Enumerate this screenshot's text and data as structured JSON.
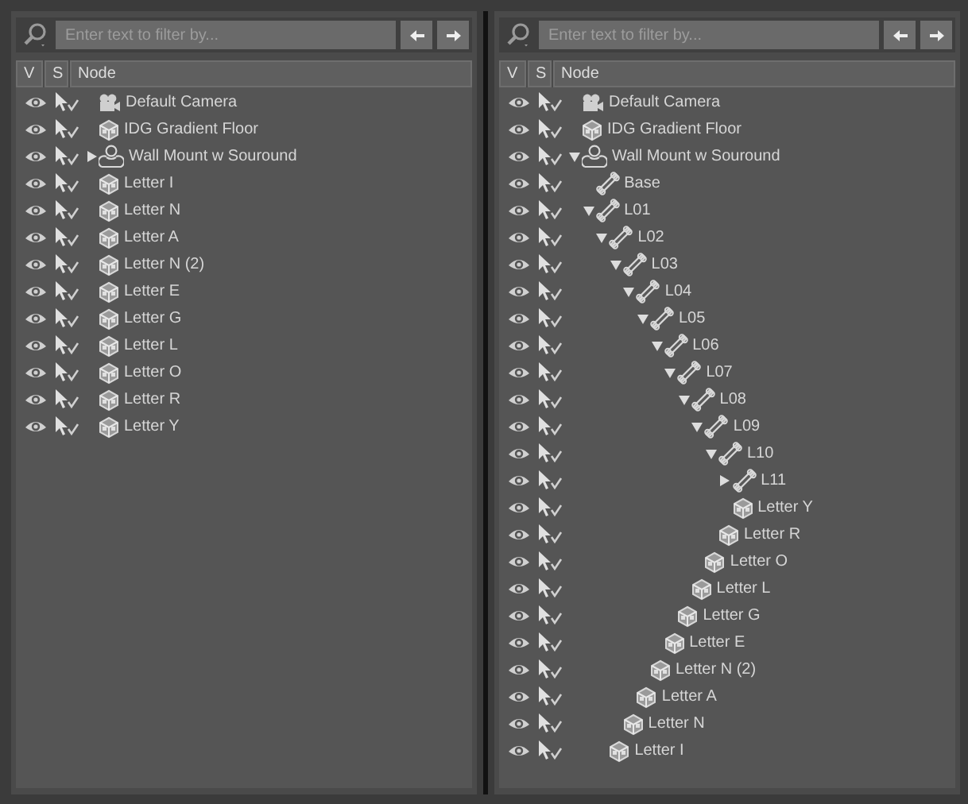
{
  "panels": [
    {
      "filter": {
        "placeholder": "Enter text to filter by..."
      },
      "columns": [
        "V",
        "S",
        "Node"
      ],
      "nodes": [
        {
          "kind": "camera",
          "label": "Default Camera"
        },
        {
          "kind": "prop",
          "label": "IDG Gradient Floor"
        },
        {
          "kind": "figure",
          "label": "Wall Mount w Souround",
          "expanded": false
        },
        {
          "kind": "prop",
          "label": "Letter I"
        },
        {
          "kind": "prop",
          "label": "Letter N"
        },
        {
          "kind": "prop",
          "label": "Letter A"
        },
        {
          "kind": "prop",
          "label": "Letter N (2)"
        },
        {
          "kind": "prop",
          "label": "Letter E"
        },
        {
          "kind": "prop",
          "label": "Letter G"
        },
        {
          "kind": "prop",
          "label": "Letter L"
        },
        {
          "kind": "prop",
          "label": "Letter O"
        },
        {
          "kind": "prop",
          "label": "Letter R"
        },
        {
          "kind": "prop",
          "label": "Letter Y"
        }
      ]
    },
    {
      "filter": {
        "placeholder": "Enter text to filter by..."
      },
      "columns": [
        "V",
        "S",
        "Node"
      ],
      "nodes": [
        {
          "kind": "camera",
          "label": "Default Camera"
        },
        {
          "kind": "prop",
          "label": "IDG Gradient Floor"
        },
        {
          "kind": "figure",
          "label": "Wall Mount w Souround",
          "expanded": true,
          "children": [
            {
              "kind": "bone",
              "label": "Base"
            },
            {
              "kind": "bone",
              "label": "L01",
              "expanded": true,
              "children": [
                {
                  "kind": "bone",
                  "label": "L02",
                  "expanded": true,
                  "children": [
                    {
                      "kind": "bone",
                      "label": "L03",
                      "expanded": true,
                      "children": [
                        {
                          "kind": "bone",
                          "label": "L04",
                          "expanded": true,
                          "children": [
                            {
                              "kind": "bone",
                              "label": "L05",
                              "expanded": true,
                              "children": [
                                {
                                  "kind": "bone",
                                  "label": "L06",
                                  "expanded": true,
                                  "children": [
                                    {
                                      "kind": "bone",
                                      "label": "L07",
                                      "expanded": true,
                                      "children": [
                                        {
                                          "kind": "bone",
                                          "label": "L08",
                                          "expanded": true,
                                          "children": [
                                            {
                                              "kind": "bone",
                                              "label": "L09",
                                              "expanded": true,
                                              "children": [
                                                {
                                                  "kind": "bone",
                                                  "label": "L10",
                                                  "expanded": true,
                                                  "children": [
                                                    {
                                                      "kind": "bone",
                                                      "label": "L11",
                                                      "expanded": false
                                                    },
                                                    {
                                                      "kind": "prop",
                                                      "label": "Letter Y"
                                                    }
                                                  ]
                                                },
                                                {
                                                  "kind": "prop",
                                                  "label": "Letter R"
                                                }
                                              ]
                                            },
                                            {
                                              "kind": "prop",
                                              "label": "Letter O"
                                            }
                                          ]
                                        },
                                        {
                                          "kind": "prop",
                                          "label": "Letter L"
                                        }
                                      ]
                                    },
                                    {
                                      "kind": "prop",
                                      "label": "Letter G"
                                    }
                                  ]
                                },
                                {
                                  "kind": "prop",
                                  "label": "Letter E"
                                }
                              ]
                            },
                            {
                              "kind": "prop",
                              "label": "Letter N (2)"
                            }
                          ]
                        },
                        {
                          "kind": "prop",
                          "label": "Letter A"
                        }
                      ]
                    },
                    {
                      "kind": "prop",
                      "label": "Letter N"
                    }
                  ]
                },
                {
                  "kind": "prop",
                  "label": "Letter I"
                }
              ]
            }
          ]
        }
      ]
    }
  ]
}
